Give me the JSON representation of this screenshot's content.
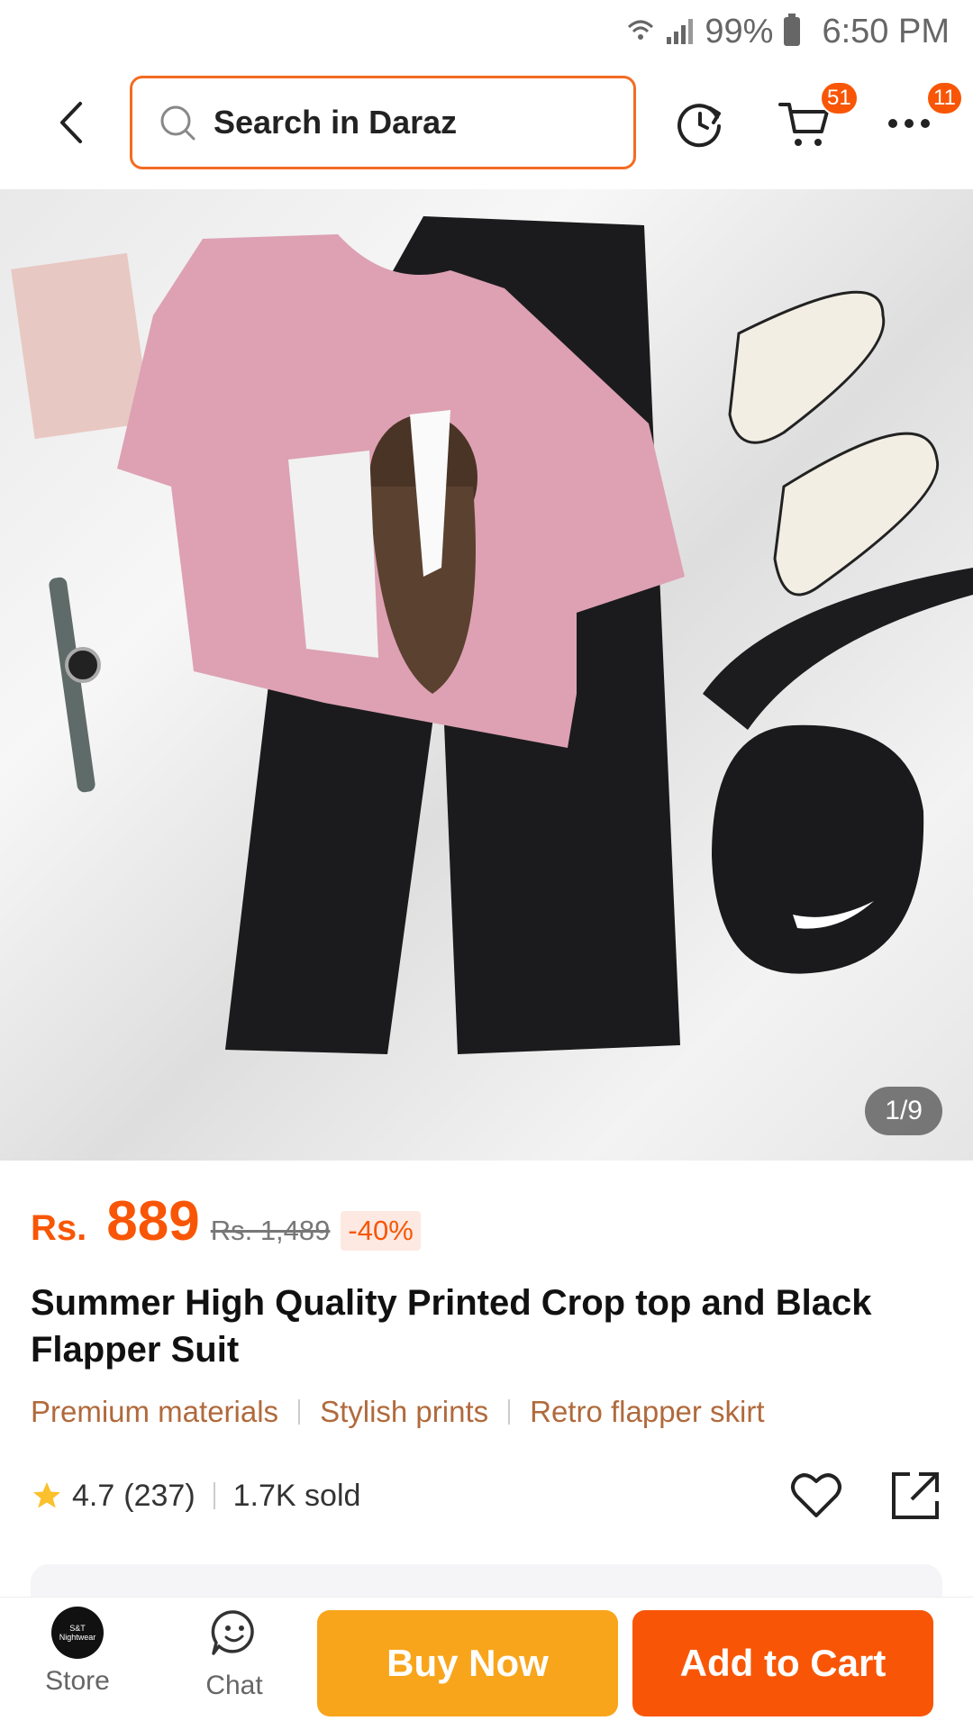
{
  "status_bar": {
    "battery": "99%",
    "time": "6:50 PM"
  },
  "header": {
    "search_placeholder": "Search in Daraz",
    "cart_badge": "51",
    "more_badge": "11"
  },
  "gallery": {
    "counter": "1/9"
  },
  "price": {
    "currency": "Rs.",
    "value": "889",
    "original": "Rs. 1,489",
    "discount": "-40%"
  },
  "product": {
    "title": "Summer High Quality Printed Crop top and Black Flapper Suit",
    "features": [
      "Premium materials",
      "Stylish prints",
      "Retro flapper skirt"
    ],
    "rating": "4.7",
    "reviews": "(237)",
    "sold": "1.7K sold"
  },
  "bottom_bar": {
    "store_label": "Store",
    "chat_label": "Chat",
    "buy_now": "Buy Now",
    "add_to_cart": "Add to Cart"
  },
  "colors": {
    "accent": "#f85606",
    "buy_now": "#f8a51c",
    "feature_text": "#b06a3c"
  }
}
